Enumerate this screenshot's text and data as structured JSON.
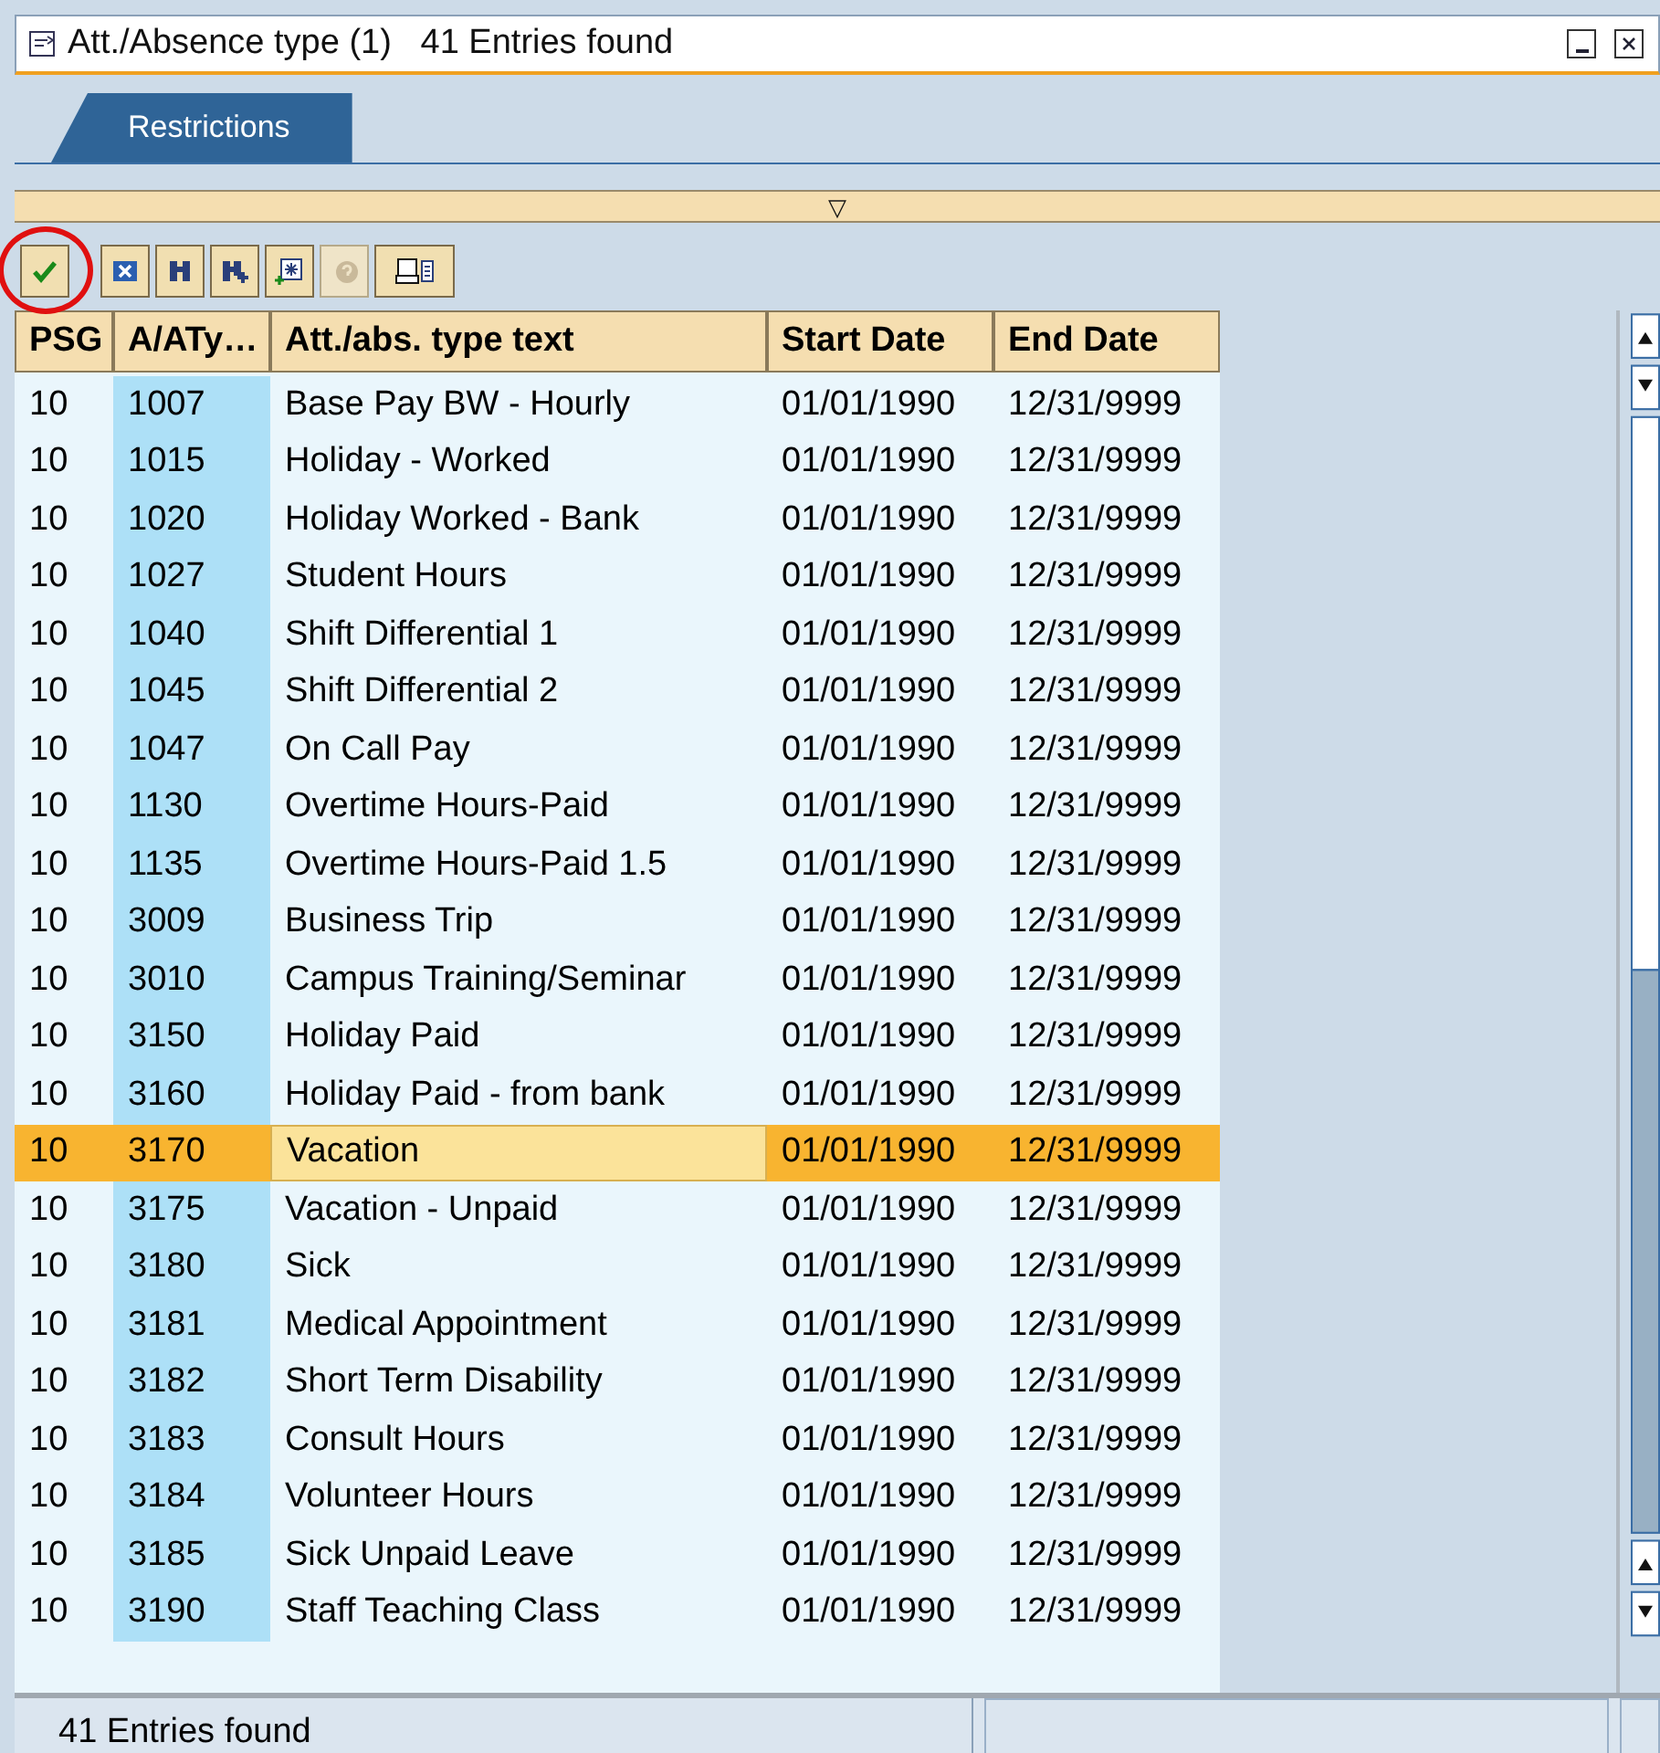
{
  "window": {
    "title": "Att./Absence type (1)   41 Entries found"
  },
  "tabs": [
    {
      "label": "Restrictions",
      "selected": true
    }
  ],
  "splitter": {
    "glyph": "▽"
  },
  "toolbar": [
    {
      "kind": "check",
      "disabled": false,
      "circled": true
    },
    {
      "kind": "cancel",
      "disabled": false
    },
    {
      "kind": "find",
      "disabled": false
    },
    {
      "kind": "find-next",
      "disabled": false
    },
    {
      "kind": "new",
      "disabled": false
    },
    {
      "kind": "help",
      "disabled": true
    },
    {
      "kind": "print",
      "disabled": false
    }
  ],
  "table": {
    "columns": [
      "PSG",
      "A/ATy…",
      "Att./abs. type text",
      "Start Date",
      "End Date"
    ],
    "rows": [
      {
        "cells": [
          "10",
          "1007",
          "Base Pay BW - Hourly",
          "01/01/1990",
          "12/31/9999"
        ],
        "selected": false
      },
      {
        "cells": [
          "10",
          "1015",
          "Holiday - Worked",
          "01/01/1990",
          "12/31/9999"
        ],
        "selected": false
      },
      {
        "cells": [
          "10",
          "1020",
          "Holiday Worked - Bank",
          "01/01/1990",
          "12/31/9999"
        ],
        "selected": false
      },
      {
        "cells": [
          "10",
          "1027",
          "Student Hours",
          "01/01/1990",
          "12/31/9999"
        ],
        "selected": false
      },
      {
        "cells": [
          "10",
          "1040",
          "Shift Differential 1",
          "01/01/1990",
          "12/31/9999"
        ],
        "selected": false
      },
      {
        "cells": [
          "10",
          "1045",
          "Shift Differential 2",
          "01/01/1990",
          "12/31/9999"
        ],
        "selected": false
      },
      {
        "cells": [
          "10",
          "1047",
          "On Call Pay",
          "01/01/1990",
          "12/31/9999"
        ],
        "selected": false
      },
      {
        "cells": [
          "10",
          "1130",
          "Overtime Hours-Paid",
          "01/01/1990",
          "12/31/9999"
        ],
        "selected": false
      },
      {
        "cells": [
          "10",
          "1135",
          "Overtime Hours-Paid 1.5",
          "01/01/1990",
          "12/31/9999"
        ],
        "selected": false
      },
      {
        "cells": [
          "10",
          "3009",
          "Business Trip",
          "01/01/1990",
          "12/31/9999"
        ],
        "selected": false
      },
      {
        "cells": [
          "10",
          "3010",
          "Campus Training/Seminar",
          "01/01/1990",
          "12/31/9999"
        ],
        "selected": false
      },
      {
        "cells": [
          "10",
          "3150",
          "Holiday Paid",
          "01/01/1990",
          "12/31/9999"
        ],
        "selected": false
      },
      {
        "cells": [
          "10",
          "3160",
          "Holiday Paid - from bank",
          "01/01/1990",
          "12/31/9999"
        ],
        "selected": false
      },
      {
        "cells": [
          "10",
          "3170",
          "Vacation",
          "01/01/1990",
          "12/31/9999"
        ],
        "selected": true
      },
      {
        "cells": [
          "10",
          "3175",
          "Vacation - Unpaid",
          "01/01/1990",
          "12/31/9999"
        ],
        "selected": false
      },
      {
        "cells": [
          "10",
          "3180",
          "Sick",
          "01/01/1990",
          "12/31/9999"
        ],
        "selected": false
      },
      {
        "cells": [
          "10",
          "3181",
          "Medical Appointment",
          "01/01/1990",
          "12/31/9999"
        ],
        "selected": false
      },
      {
        "cells": [
          "10",
          "3182",
          "Short Term Disability",
          "01/01/1990",
          "12/31/9999"
        ],
        "selected": false
      },
      {
        "cells": [
          "10",
          "3183",
          "Consult Hours",
          "01/01/1990",
          "12/31/9999"
        ],
        "selected": false
      },
      {
        "cells": [
          "10",
          "3184",
          "Volunteer Hours",
          "01/01/1990",
          "12/31/9999"
        ],
        "selected": false
      },
      {
        "cells": [
          "10",
          "3185",
          "Sick Unpaid Leave",
          "01/01/1990",
          "12/31/9999"
        ],
        "selected": false
      },
      {
        "cells": [
          "10",
          "3190",
          "Staff Teaching Class",
          "01/01/1990",
          "12/31/9999"
        ],
        "selected": false
      }
    ]
  },
  "status_bar": {
    "text": "41 Entries found"
  }
}
